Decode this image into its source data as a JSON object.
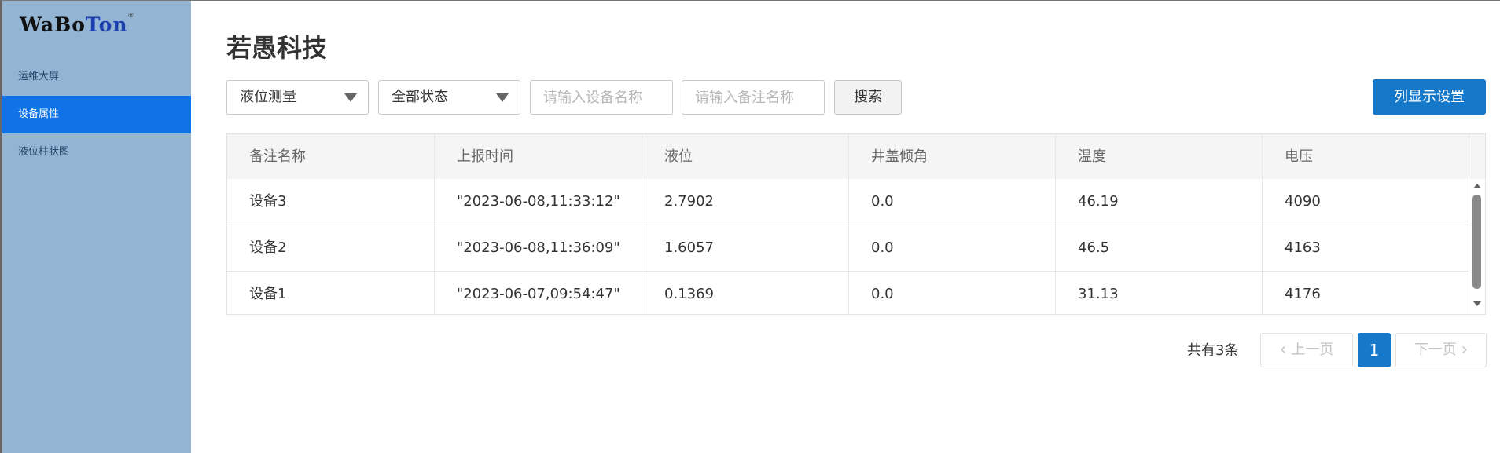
{
  "sidebar": {
    "logo": {
      "part1": "WaBo",
      "part2": "Ton",
      "mark": "®"
    },
    "items": [
      {
        "label": "运维大屏"
      },
      {
        "label": "设备属性"
      },
      {
        "label": "液位柱状图"
      }
    ],
    "active_index": 1
  },
  "main": {
    "title": "若愚科技"
  },
  "filters": {
    "type_select": "液位测量",
    "status_select": "全部状态",
    "device_name_placeholder": "请输入设备名称",
    "remark_name_placeholder": "请输入备注名称",
    "search_label": "搜索",
    "column_settings_label": "列显示设置"
  },
  "table": {
    "headers": [
      "备注名称",
      "上报时间",
      "液位",
      "井盖倾角",
      "温度",
      "电压"
    ],
    "rows": [
      [
        "设备3",
        "\"2023-06-08,11:33:12\"",
        "2.7902",
        "0.0",
        "46.19",
        "4090"
      ],
      [
        "设备2",
        "\"2023-06-08,11:36:09\"",
        "1.6057",
        "0.0",
        "46.5",
        "4163"
      ],
      [
        "设备1",
        "\"2023-06-07,09:54:47\"",
        "0.1369",
        "0.0",
        "31.13",
        "4176"
      ]
    ]
  },
  "pagination": {
    "total_text": "共有3条",
    "prev_label": "上一页",
    "current_page": "1",
    "next_label": "下一页"
  },
  "colors": {
    "sidebar_bg": "#93b4d2",
    "active_item": "#0f72e6",
    "primary_button": "#1578c8"
  }
}
